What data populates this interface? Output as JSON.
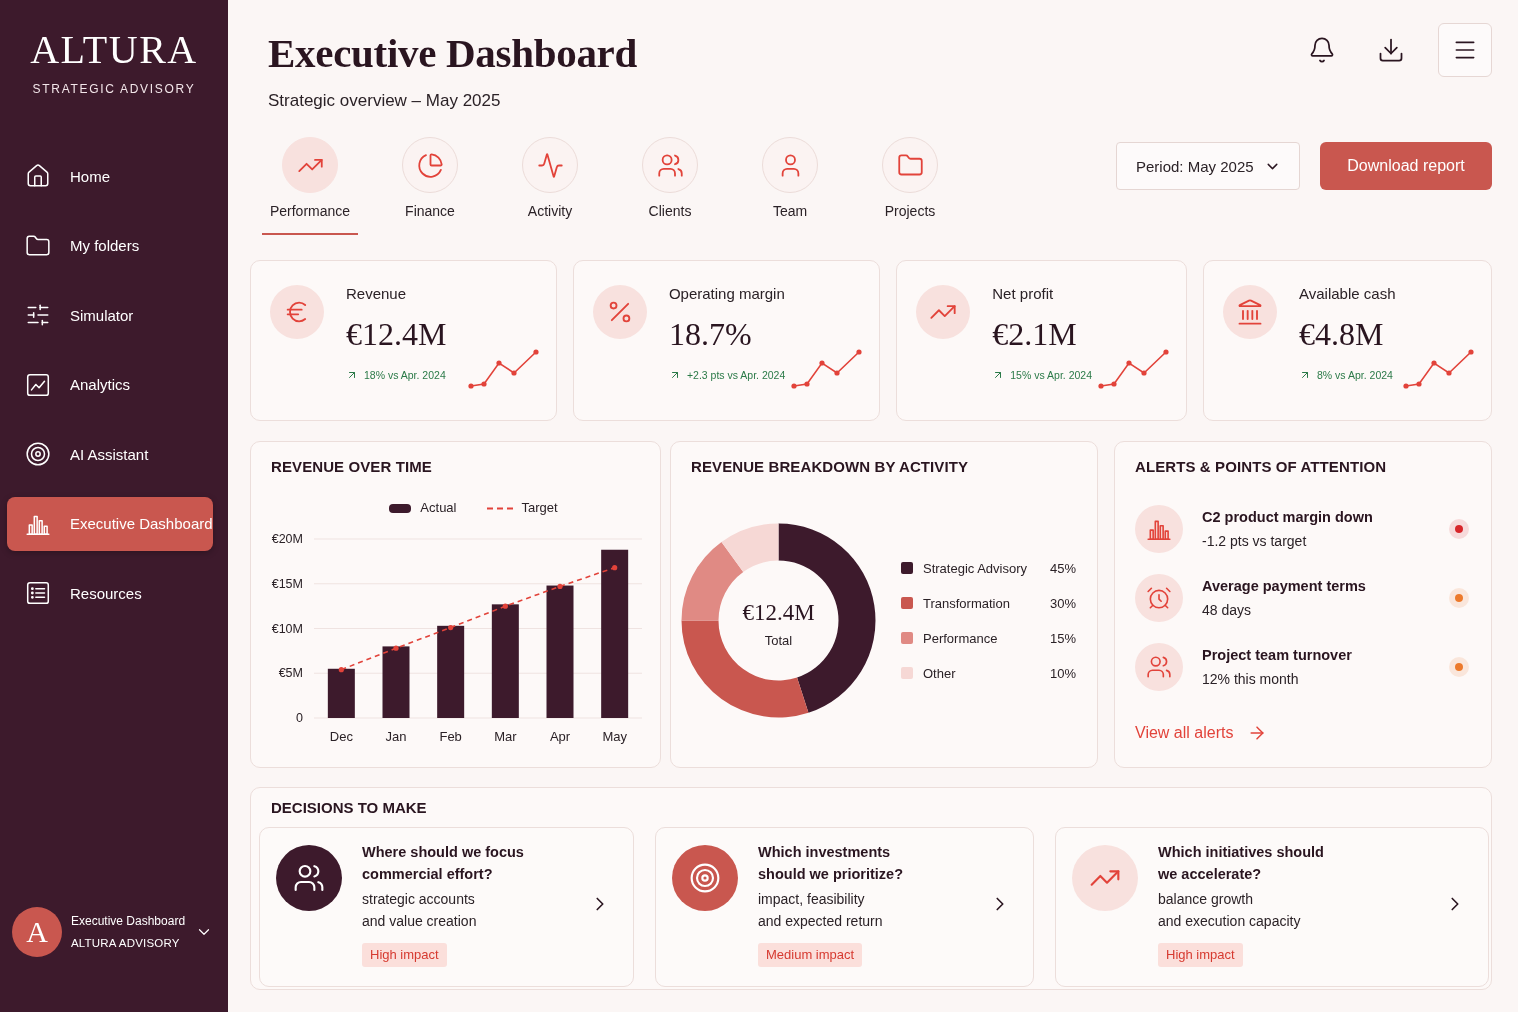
{
  "sidebar": {
    "brand": {
      "name": "ALTURA",
      "tagline": "STRATEGIC ADVISORY"
    },
    "nav": [
      {
        "label": "Home",
        "selected": false
      },
      {
        "label": "My folders",
        "selected": false
      },
      {
        "label": "Simulator",
        "selected": false
      },
      {
        "label": "Analytics",
        "selected": false
      },
      {
        "label": "AI Assistant",
        "selected": false
      },
      {
        "label": "Executive Dashboard",
        "selected": true
      },
      {
        "label": "Resources",
        "selected": false
      }
    ],
    "account": {
      "initial": "A",
      "name": "Executive Dashboard",
      "organization": "ALTURA ADVISORY"
    }
  },
  "header": {
    "title": "Executive Dashboard",
    "subtitle": "Strategic overview – May 2025"
  },
  "tabs": [
    {
      "label": "Performance",
      "selected": true
    },
    {
      "label": "Finance",
      "selected": false
    },
    {
      "label": "Activity",
      "selected": false
    },
    {
      "label": "Clients",
      "selected": false
    },
    {
      "label": "Team",
      "selected": false
    },
    {
      "label": "Projects",
      "selected": false
    }
  ],
  "period_select": {
    "value": "Period: May 2025"
  },
  "download_button": {
    "label": "Download report"
  },
  "kpis": [
    {
      "label": "Revenue",
      "value": "€12.4M",
      "change": "18% vs Apr. 2024"
    },
    {
      "label": "Operating margin",
      "value": "18.7%",
      "change": "+2.3 pts vs Apr. 2024"
    },
    {
      "label": "Net profit",
      "value": "€2.1M",
      "change": "15% vs Apr. 2024"
    },
    {
      "label": "Available cash",
      "value": "€4.8M",
      "change": "8% vs Apr. 2024"
    }
  ],
  "revenue_over_time": {
    "title": "REVENUE OVER TIME",
    "chart_data": {
      "type": "bar",
      "legend": "top",
      "grid": true,
      "categories": [
        "Dec",
        "Jan",
        "Feb",
        "Mar",
        "Apr",
        "May"
      ],
      "series": [
        {
          "name": "Actual",
          "color": "#3d1a2c",
          "values": [
            5.5,
            8.0,
            10.3,
            12.7,
            14.8,
            18.8
          ]
        },
        {
          "name": "Target",
          "type": "line",
          "line_style": "dashed",
          "color": "#e2433a",
          "values": [
            5.4,
            7.8,
            10.1,
            12.5,
            14.7,
            16.8
          ]
        }
      ],
      "ylim": [
        0,
        20
      ],
      "yticks": [
        {
          "value": 0,
          "label": "0"
        },
        {
          "value": 5,
          "label": "€5M"
        },
        {
          "value": 10,
          "label": "€10M"
        },
        {
          "value": 15,
          "label": "€15M"
        },
        {
          "value": 20,
          "label": "€20M"
        }
      ]
    }
  },
  "revenue_breakdown": {
    "title": "REVENUE BREAKDOWN BY ACTIVITY",
    "center_value": "€12.4M",
    "center_label": "Total",
    "chart_data": {
      "type": "donut",
      "legend": "right",
      "categories": [
        "Strategic Advisory",
        "Transformation",
        "Performance",
        "Other"
      ],
      "values": [
        45,
        30,
        15,
        10
      ]
    },
    "legend": [
      {
        "share": "45%",
        "color": "#3d1a2c"
      },
      {
        "share": "30%",
        "color": "#c9574f"
      },
      {
        "share": "15%",
        "color": "#e08a84"
      },
      {
        "share": "10%",
        "color": "#f6d8d5"
      }
    ]
  },
  "alerts": {
    "title": "ALERTS & POINTS OF ATTENTION",
    "items": [
      {
        "title": "C2 product margin down",
        "detail": "-1.2 pts vs target",
        "color": "#d7262b"
      },
      {
        "title": "Average payment terms",
        "detail": "48 days",
        "color": "#ec7a2c"
      },
      {
        "title": "Project team turnover",
        "detail": "12% this month",
        "color": "#ec7a2c"
      }
    ],
    "link": "View all alerts"
  },
  "decisions": {
    "title": "DECISIONS TO MAKE",
    "items": [
      {
        "question": "Where should we focus\ncommercial effort?",
        "detail": "strategic accounts\nand value creation",
        "impact": "High impact"
      },
      {
        "question": "Which investments\nshould we prioritize?",
        "detail": "impact, feasibility\nand expected return",
        "impact": "Medium impact"
      },
      {
        "question": "Which initiatives should\nwe accelerate?",
        "detail": "balance growth\nand execution capacity",
        "impact": "High impact"
      }
    ]
  }
}
